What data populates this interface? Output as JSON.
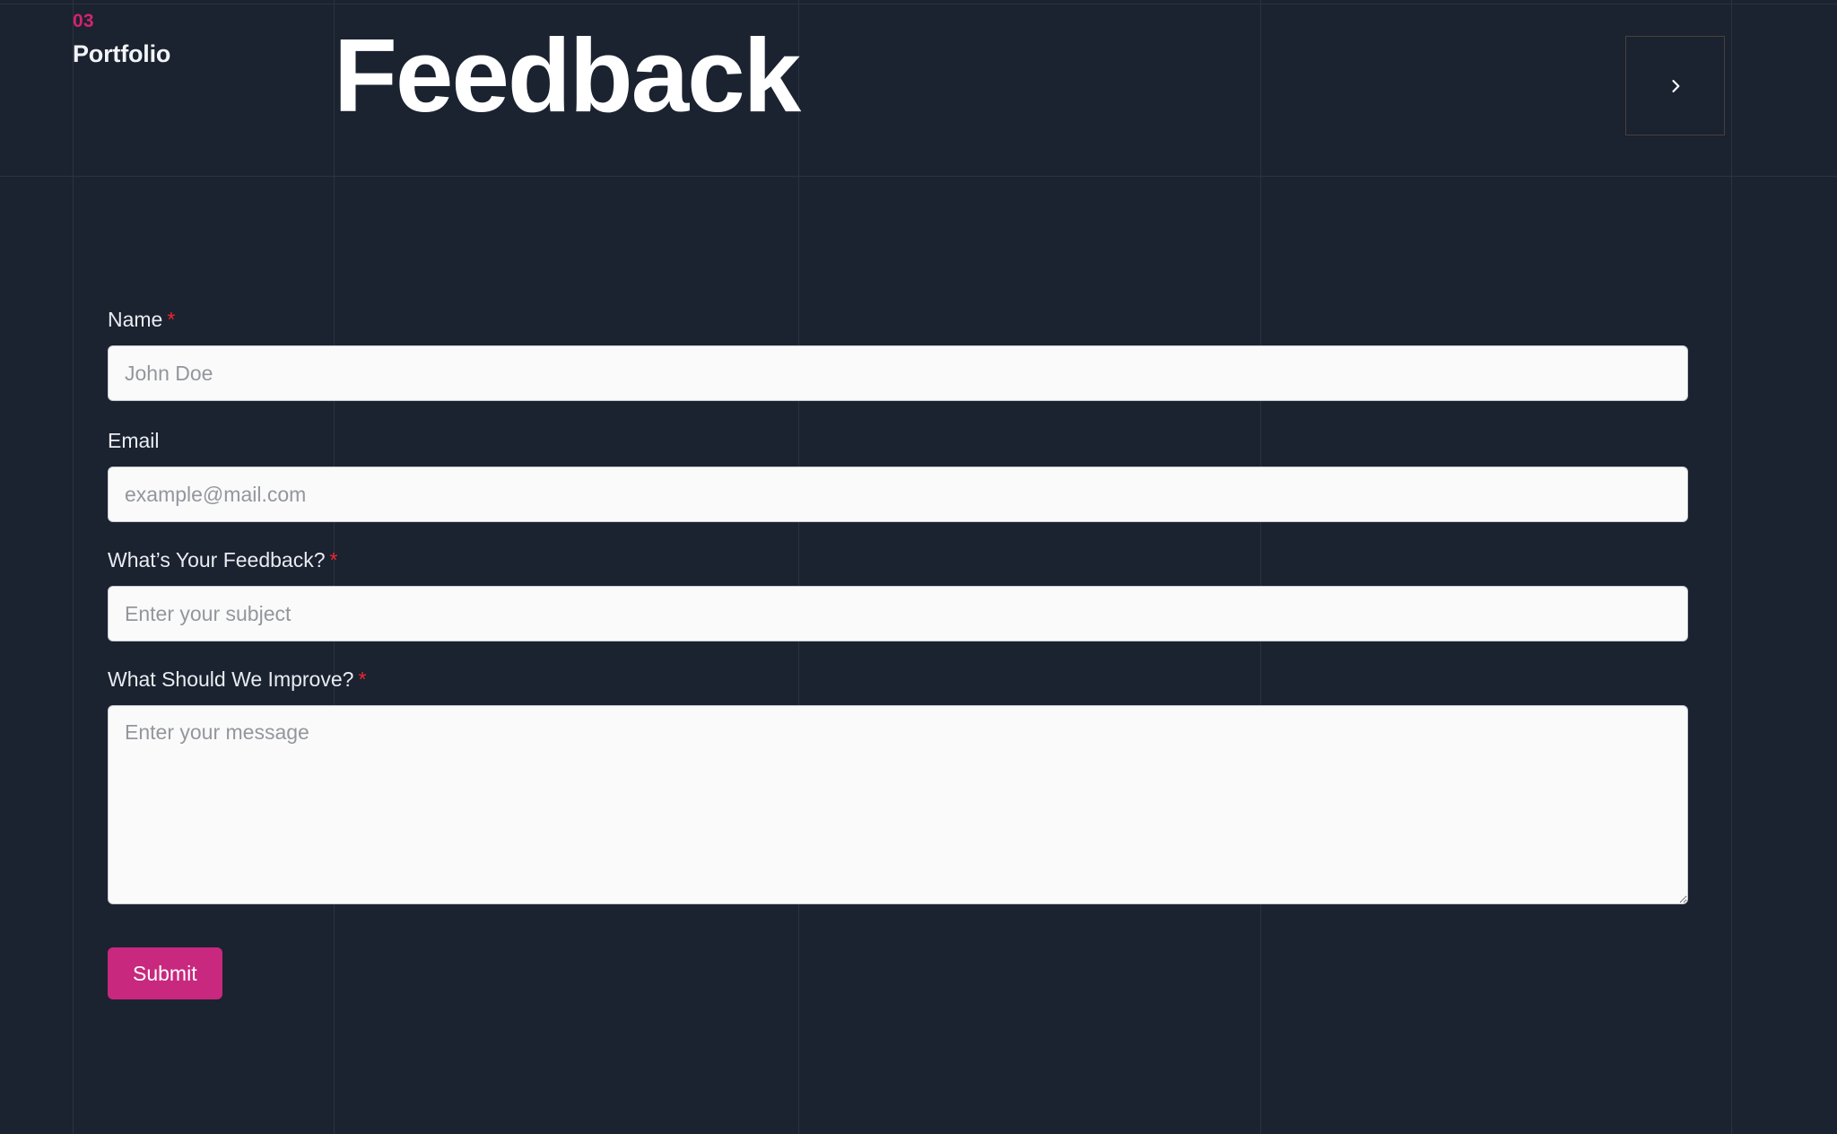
{
  "theme": {
    "background": "#1b2230",
    "grid_line": "#2b3342",
    "accent_pink": "#d2246d",
    "submit_pink": "#c8287e",
    "required_red": "#f0262c",
    "input_background": "#fafafa",
    "input_border": "#c8ccd2",
    "placeholder_text": "#93979d",
    "heading_text": "#ffffff"
  },
  "header": {
    "eyebrow": "03",
    "section_name": "Portfolio",
    "title": "Feedback",
    "next_button": {
      "icon": "chevron-right-icon",
      "label": ""
    }
  },
  "form": {
    "fields": [
      {
        "id": "name",
        "label": "Name",
        "required": true,
        "required_marker": "*",
        "placeholder": "John Doe",
        "value": "",
        "type": "text"
      },
      {
        "id": "email",
        "label": "Email",
        "required": false,
        "required_marker": "",
        "placeholder": "example@mail.com",
        "value": "",
        "type": "text"
      },
      {
        "id": "subject",
        "label": "What’s Your Feedback?",
        "required": true,
        "required_marker": "*",
        "placeholder": "Enter your subject",
        "value": "",
        "type": "text"
      },
      {
        "id": "message",
        "label": "What Should We Improve?",
        "required": true,
        "required_marker": "*",
        "placeholder": "Enter your message",
        "value": "",
        "type": "textarea"
      }
    ],
    "submit_label": "Submit"
  },
  "grid": {
    "vertical_lines": [
      81,
      372,
      890,
      1405,
      1930
    ],
    "horizontal_lines": [
      4,
      196
    ]
  }
}
